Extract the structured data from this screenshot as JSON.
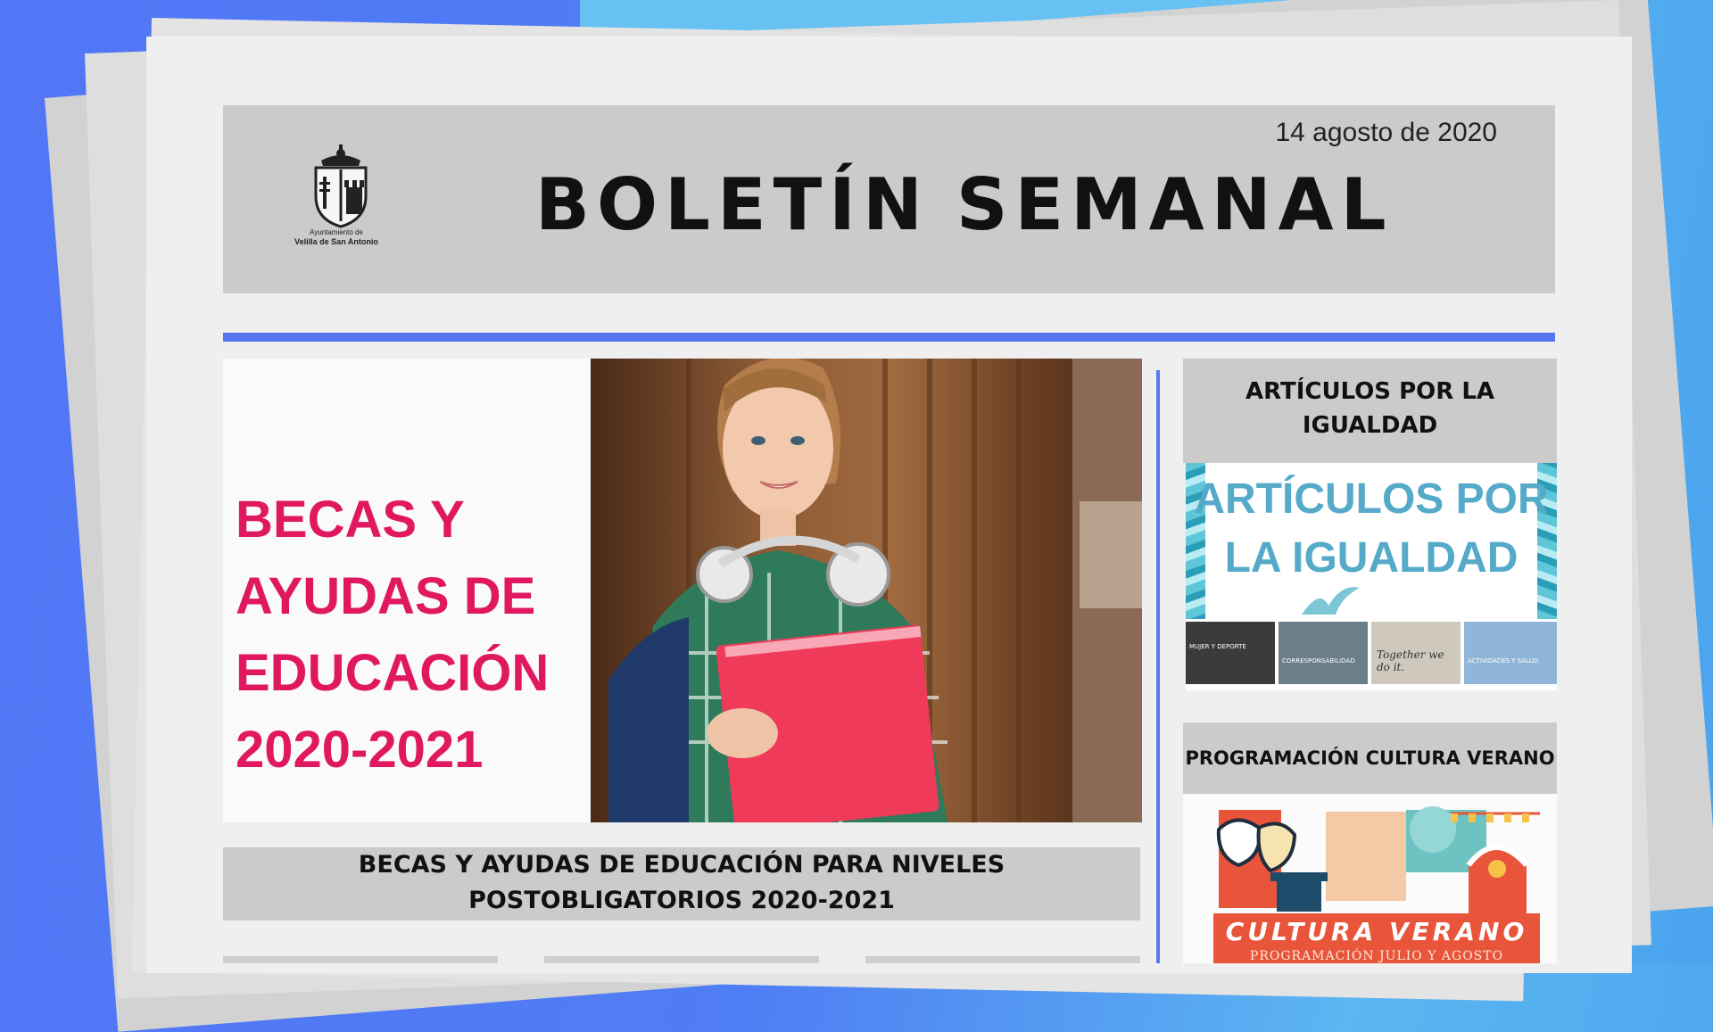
{
  "header": {
    "date": "14 agosto de 2020",
    "title_word1": "BOLETÍN",
    "title_word2": "SEMANAL",
    "logo_caption_line1": "Ayuntamiento de",
    "logo_caption_line2": "Velilla de San Antonio"
  },
  "feature": {
    "image_text": [
      "BECAS Y",
      "AYUDAS DE",
      "EDUCACIÓN",
      "2020-2021"
    ],
    "caption_line1": "BECAS Y AYUDAS DE EDUCACIÓN PARA NIVELES",
    "caption_line2": "POSTOBLIGATORIOS 2020-2021"
  },
  "sidebar": {
    "card1": {
      "heading_line1": "ARTÍCULOS POR LA",
      "heading_line2": "IGUALDAD",
      "image_title_line1": "ARTÍCULOS POR",
      "image_title_line2": "LA IGUALDAD",
      "image_small1": "MUJER Y DEPORTE",
      "image_small2": "CORRESPONSABILIDAD",
      "image_small3": "Together we do it.",
      "image_small4": "ACTIVIDADES Y SALUD"
    },
    "card2": {
      "heading": "PROGRAMACIÓN CULTURA VERANO",
      "image_title": "CULTURA VERANO",
      "image_subtitle": "PROGRAMACIÓN JULIO Y AGOSTO"
    }
  },
  "colors": {
    "accent_blue": "#5275f0",
    "header_gray": "#cbcbcb",
    "feature_pink": "#e0185f",
    "igualdad_teal": "#55a9c9",
    "cultura_orange": "#e8553b"
  }
}
